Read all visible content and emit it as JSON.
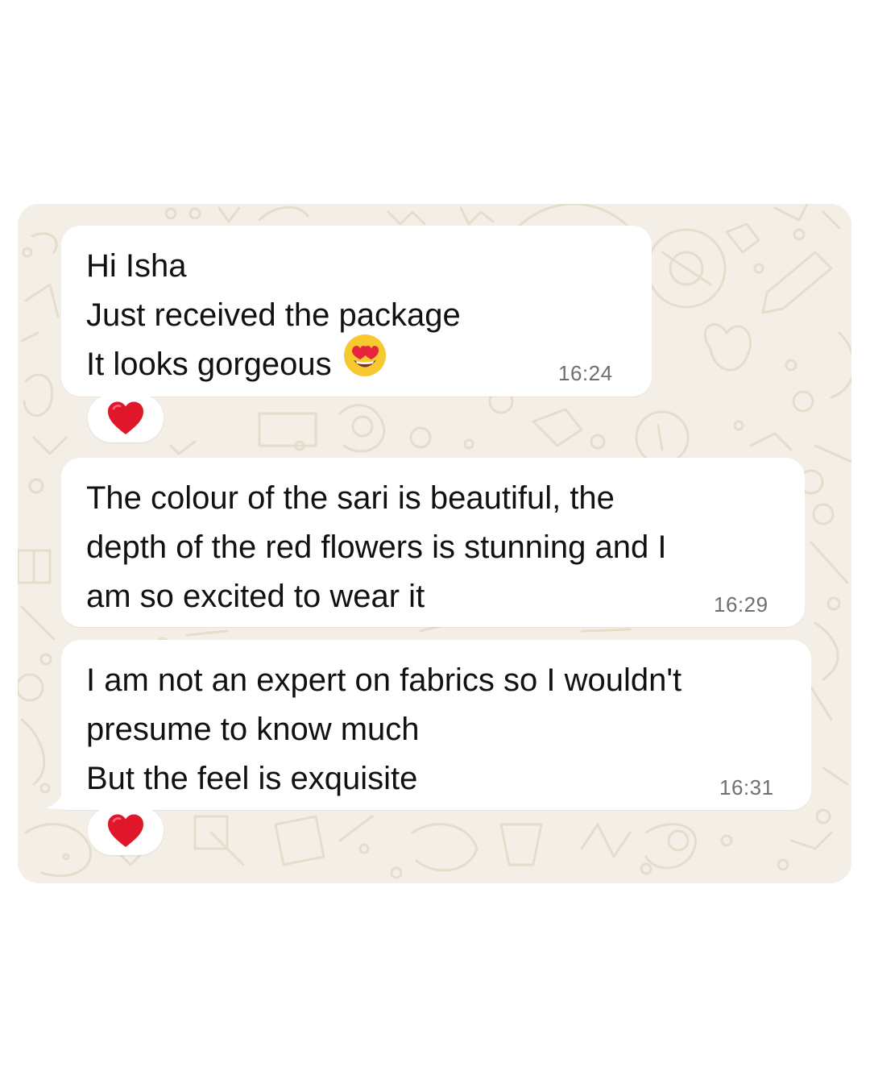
{
  "messages": [
    {
      "lines": [
        "Hi Isha",
        "Just received the package",
        "It looks gorgeous"
      ],
      "emoji": "heart-eyes-face-icon",
      "time": "16:24",
      "reaction": "red-heart-icon"
    },
    {
      "lines": [
        "The colour of the sari is beautiful, the",
        "depth of the red flowers is stunning and I",
        "am so excited to wear it"
      ],
      "time": "16:29"
    },
    {
      "lines": [
        "I am not an expert on fabrics so I wouldn't",
        "presume to know much",
        "But the feel is exquisite"
      ],
      "time": "16:31",
      "reaction": "red-heart-icon"
    }
  ],
  "colors": {
    "wallpaper": "#f4efe6",
    "bubble": "#ffffff",
    "text": "#111111",
    "time": "#6f6f6f",
    "heart": "#e0172b"
  }
}
